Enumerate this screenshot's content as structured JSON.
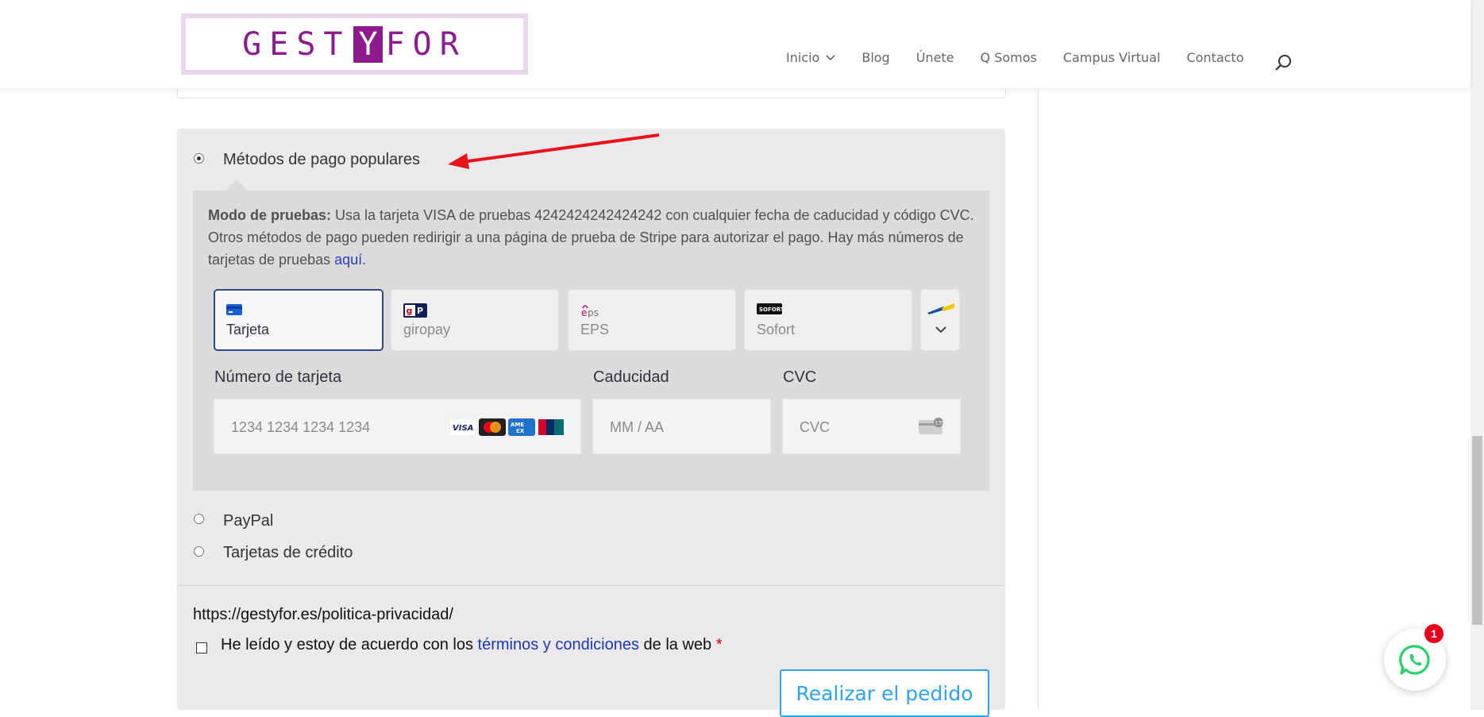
{
  "header": {
    "logo_text_left": "GEST",
    "logo_text_mark": "Y",
    "logo_text_right": "FOR",
    "nav": [
      {
        "label": "Inicio",
        "has_dropdown": true
      },
      {
        "label": "Blog"
      },
      {
        "label": "Únete"
      },
      {
        "label": "Q Somos"
      },
      {
        "label": "Campus Virtual"
      },
      {
        "label": "Contacto"
      }
    ]
  },
  "payment": {
    "methods": [
      {
        "label": "Métodos de pago populares",
        "selected": true
      },
      {
        "label": "PayPal",
        "selected": false
      },
      {
        "label": "Tarjetas de crédito",
        "selected": false
      }
    ],
    "notice": {
      "bold": "Modo de pruebas:",
      "text": " Usa la tarjeta VISA de pruebas 4242424242424242 con cualquier fecha de caducidad y código CVC. Otros métodos de pago pueden redirigir a una página de prueba de Stripe para autorizar el pago. Hay más números de tarjetas de pruebas ",
      "link": "aquí",
      "end": "."
    },
    "tabs": [
      {
        "label": "Tarjeta",
        "icon": "card-icon",
        "active": true
      },
      {
        "label": "giropay",
        "icon": "giropay-icon",
        "active": false
      },
      {
        "label": "EPS",
        "icon": "eps-icon",
        "active": false
      },
      {
        "label": "Sofort",
        "icon": "sofort-icon",
        "active": false
      }
    ],
    "fields": {
      "card_number_label": "Número de tarjeta",
      "card_number_placeholder": "1234 1234 1234 1234",
      "expiry_label": "Caducidad",
      "expiry_placeholder": "MM / AA",
      "cvc_label": "CVC",
      "cvc_placeholder": "CVC"
    },
    "card_brands": [
      "visa",
      "mastercard",
      "amex",
      "unionpay"
    ],
    "cvc_icon_text": "135"
  },
  "privacy_url": "https://gestyfor.es/politica-privacidad/",
  "terms": {
    "before": "He leído y estoy de acuerdo con los ",
    "link": "términos y condiciones",
    "after": " de la web ",
    "required": "*"
  },
  "order_button": "Realizar el pedido",
  "whatsapp_badge": "1",
  "colors": {
    "brand": "#8e1b8e",
    "accent": "#2ea3f2",
    "active_tab_border": "#2c4a8a",
    "arrow": "#e8141c"
  }
}
